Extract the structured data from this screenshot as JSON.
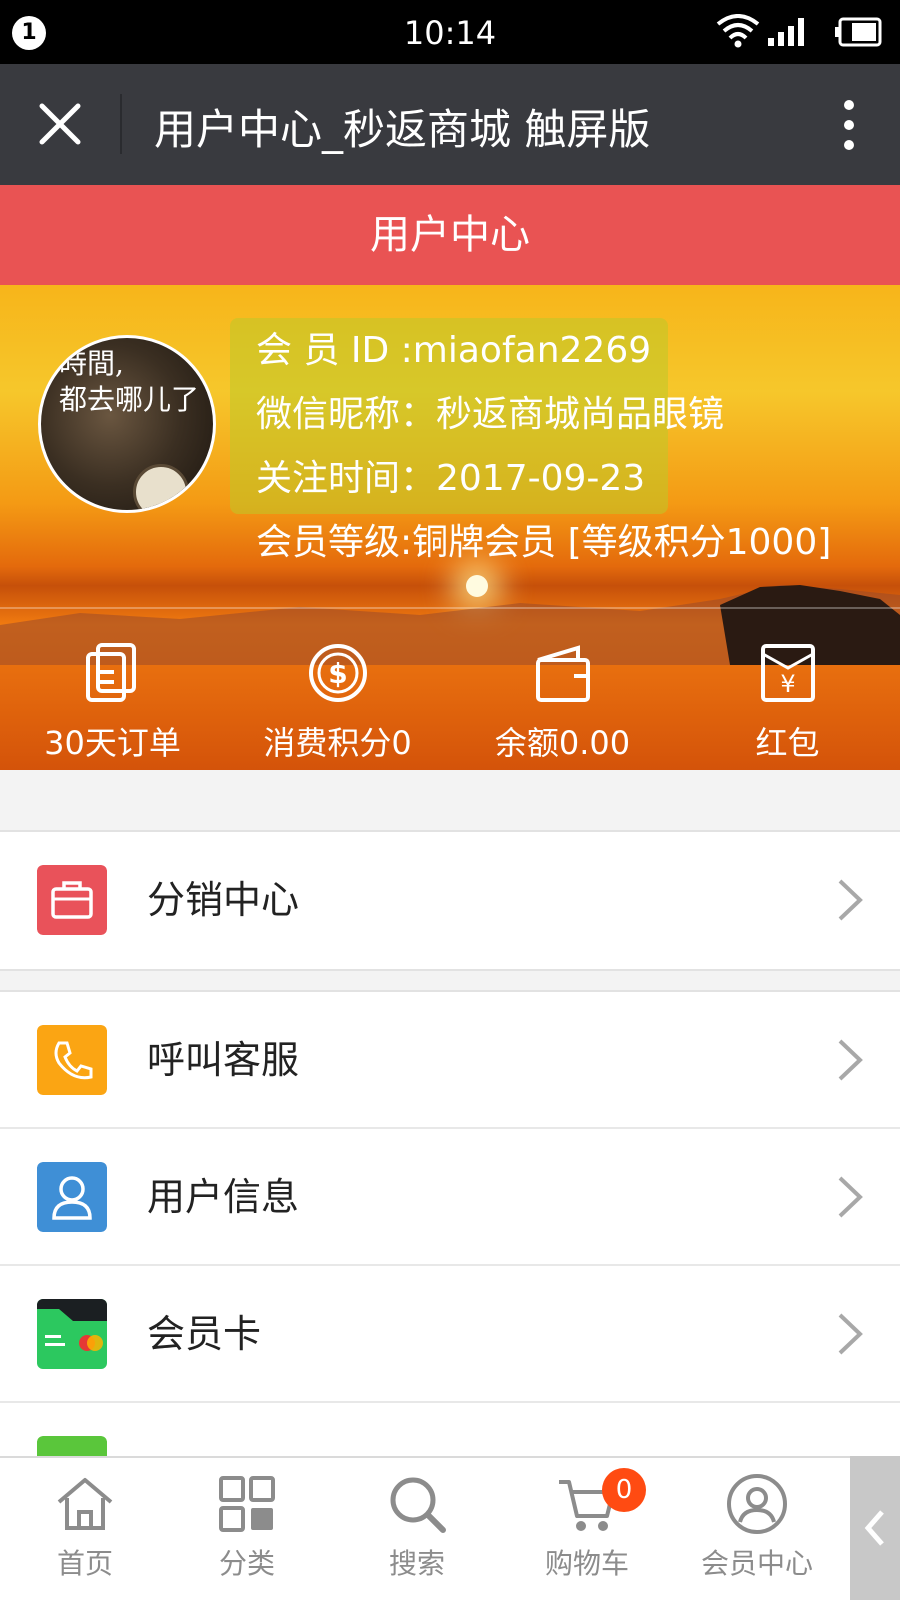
{
  "status_bar": {
    "notification_count": "1",
    "time": "10:14"
  },
  "browser_bar": {
    "title": "用户中心_秒返商城 触屏版"
  },
  "page_header": {
    "title": "用户中心"
  },
  "profile": {
    "avatar_text_line1": "時間,",
    "avatar_text_line2": "都去哪儿了",
    "member_id": "会 员 ID :miaofan2269",
    "nickname": "微信昵称：秒返商城尚品眼镜",
    "follow_time": "关注时间：2017-09-23",
    "member_level": "会员等级:铜牌会员 [等级积分1000]"
  },
  "stats": [
    {
      "label": "30天订单",
      "icon": "orders-icon"
    },
    {
      "label": "消费积分0",
      "icon": "coin-icon"
    },
    {
      "label": "余额0.00",
      "icon": "wallet-icon"
    },
    {
      "label": "红包",
      "icon": "red-packet-icon"
    }
  ],
  "menu_group1": [
    {
      "label": "分销中心",
      "icon": "briefcase-icon",
      "color": "#e9525a"
    }
  ],
  "menu_group2": [
    {
      "label": "呼叫客服",
      "icon": "phone-icon",
      "color": "#fba513"
    },
    {
      "label": "用户信息",
      "icon": "user-icon",
      "color": "#3f8fd6"
    },
    {
      "label": "会员卡",
      "icon": "member-card-icon",
      "color": "#2cc85f"
    }
  ],
  "tabs": [
    {
      "label": "首页",
      "icon": "home-icon"
    },
    {
      "label": "分类",
      "icon": "category-icon"
    },
    {
      "label": "搜索",
      "icon": "search-icon"
    },
    {
      "label": "购物车",
      "icon": "cart-icon",
      "badge": "0"
    },
    {
      "label": "会员中心",
      "icon": "member-center-icon"
    }
  ],
  "colors": {
    "header_red": "#e95353",
    "browser_bar": "#393a3f",
    "badge": "#ff4b12"
  }
}
